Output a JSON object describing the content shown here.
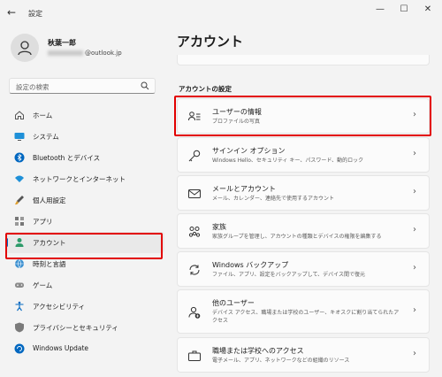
{
  "window": {
    "title": "設定",
    "back_glyph": "←",
    "min_glyph": "—",
    "max_glyph": "☐",
    "close_glyph": "✕"
  },
  "profile": {
    "name": "秋葉一郎",
    "email_suffix": "@outlook.jp"
  },
  "search": {
    "placeholder": "設定の検索"
  },
  "nav": [
    {
      "label": "ホーム",
      "icon": "home-icon"
    },
    {
      "label": "システム",
      "icon": "monitor-icon"
    },
    {
      "label": "Bluetooth とデバイス",
      "icon": "bluetooth-icon"
    },
    {
      "label": "ネットワークとインターネット",
      "icon": "wifi-icon"
    },
    {
      "label": "個人用設定",
      "icon": "brush-icon"
    },
    {
      "label": "アプリ",
      "icon": "apps-icon"
    },
    {
      "label": "アカウント",
      "icon": "account-icon",
      "active": true
    },
    {
      "label": "時刻と言語",
      "icon": "globe-clock-icon"
    },
    {
      "label": "ゲーム",
      "icon": "gamepad-icon"
    },
    {
      "label": "アクセシビリティ",
      "icon": "accessibility-icon"
    },
    {
      "label": "プライバシーとセキュリティ",
      "icon": "shield-icon"
    },
    {
      "label": "Windows Update",
      "icon": "update-icon"
    }
  ],
  "main": {
    "title": "アカウント",
    "section_heading": "アカウントの設定",
    "cards": [
      {
        "title": "ユーザーの情報",
        "subtitle": "プロファイルの写真",
        "icon": "user-info-icon"
      },
      {
        "title": "サインイン オプション",
        "subtitle": "Windows Hello、セキュリティ キー、パスワード、動的ロック",
        "icon": "key-icon"
      },
      {
        "title": "メールとアカウント",
        "subtitle": "メール、カレンダー、連絡先で使用するアカウント",
        "icon": "mail-icon"
      },
      {
        "title": "家族",
        "subtitle": "家族グループを管理し、アカウントの種類とデバイスの権限を編集する",
        "icon": "family-icon"
      },
      {
        "title": "Windows バックアップ",
        "subtitle": "ファイル、アプリ、設定をバックアップして、デバイス間で復元",
        "icon": "backup-icon"
      },
      {
        "title": "他のユーザー",
        "subtitle": "デバイス アクセス、職場または学校のユーザー、キオスクに割り当てられたアクセス",
        "icon": "add-user-icon"
      },
      {
        "title": "職場または学校へのアクセス",
        "subtitle": "電子メール、アプリ、ネットワークなどの組織のリソース",
        "icon": "briefcase-icon"
      }
    ],
    "chevron": "›"
  },
  "colors": {
    "accent": "#0067c0",
    "highlight": "#e20000",
    "background": "#f3f3f3",
    "card": "#fbfbfb"
  }
}
